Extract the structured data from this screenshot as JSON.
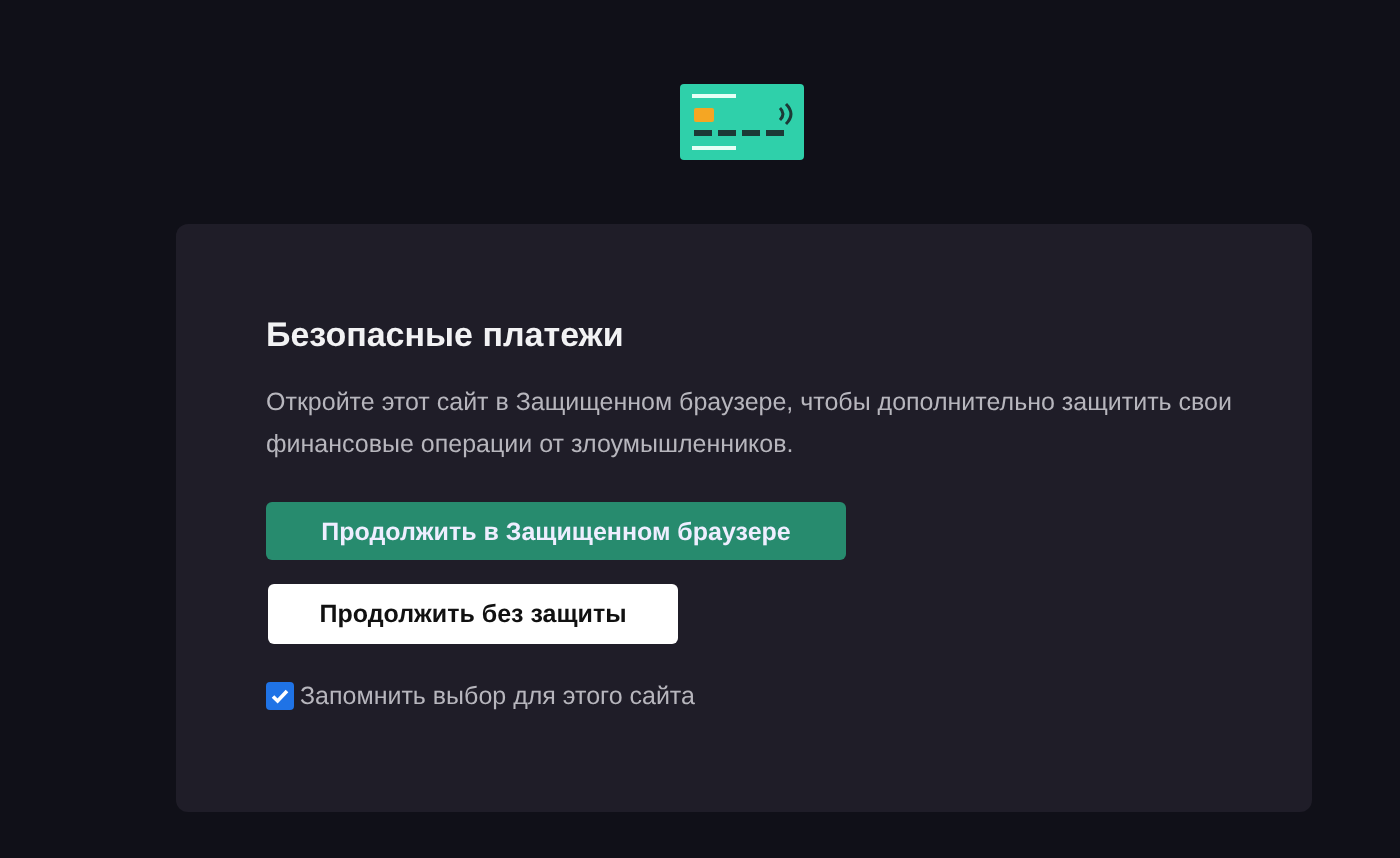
{
  "dialog": {
    "title": "Безопасные платежи",
    "description": "Откройте этот сайт в Защищенном браузере, чтобы дополнительно защитить свои финансовые операции от злоумышленников.",
    "buttons": [
      {
        "label": "Продолжить в Защищенном браузере",
        "kind": "primary"
      },
      {
        "label": "Продолжить без защиты",
        "kind": "secondary"
      }
    ],
    "remember": {
      "label": "Запомнить выбор для этого сайта",
      "checked": true
    }
  }
}
